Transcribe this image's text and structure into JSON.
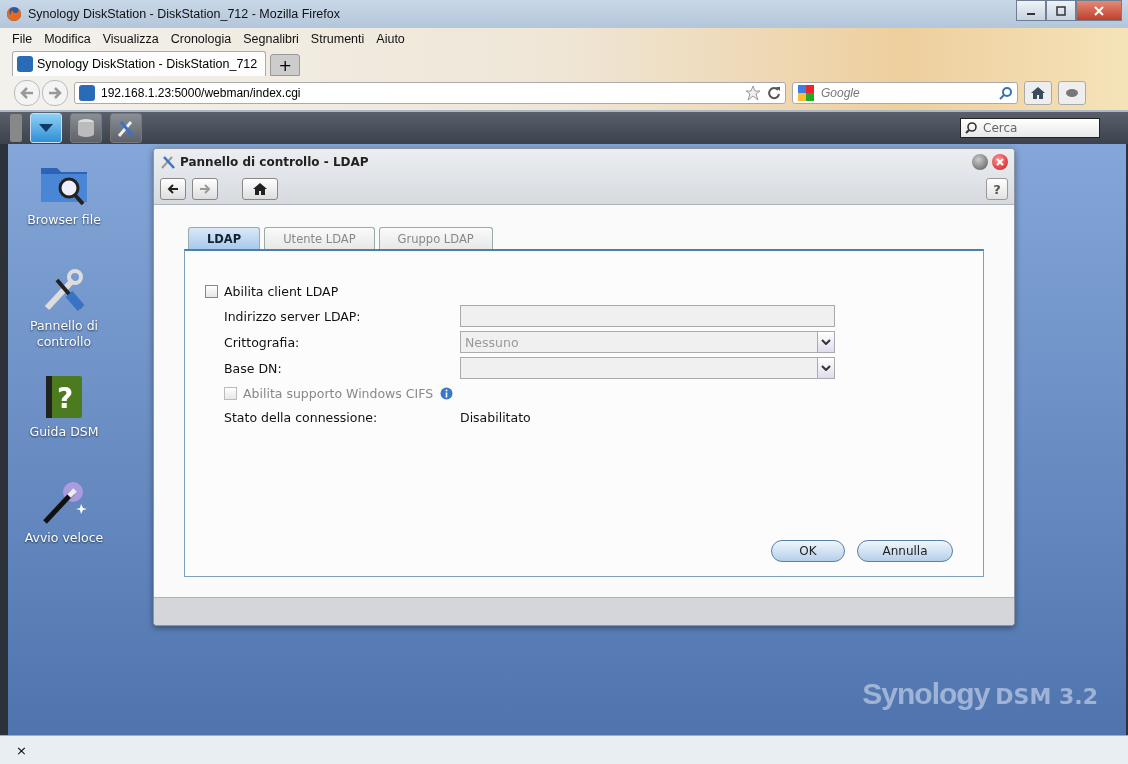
{
  "window": {
    "title": "Synology DiskStation - DiskStation_712 - Mozilla Firefox"
  },
  "menu": [
    "File",
    "Modifica",
    "Visualizza",
    "Cronologia",
    "Segnalibri",
    "Strumenti",
    "Aiuto"
  ],
  "browser_tabs": [
    {
      "label": "Synology DiskStation - DiskStation_712",
      "selected": true
    }
  ],
  "new_tab": "+",
  "address_bar": {
    "value": "192.168.1.23:5000/webman/index.cgi"
  },
  "search_bar": {
    "placeholder": "Google"
  },
  "dsm_taskbar": {
    "search": {
      "placeholder": "Cerca"
    }
  },
  "desktop": {
    "icons": [
      {
        "kind": "folder",
        "label": "Browser file"
      },
      {
        "kind": "tools",
        "label": "Pannello di controllo"
      },
      {
        "kind": "help",
        "label": "Guida DSM",
        "glyph": "?"
      },
      {
        "kind": "wand",
        "label": "Avvio veloce"
      }
    ],
    "logo": {
      "brand": "Synology",
      "product": "DSM 3.2"
    }
  },
  "dialog": {
    "title": "Pannello di controllo - LDAP",
    "help": "?",
    "tabs": [
      {
        "label": "LDAP",
        "selected": true
      },
      {
        "label": "Utente LDAP",
        "selected": false
      },
      {
        "label": "Gruppo LDAP",
        "selected": false
      }
    ],
    "enable_client": {
      "label": "Abilita client LDAP",
      "checked": false
    },
    "fields": [
      {
        "kind": "text",
        "label": "Indirizzo server LDAP:",
        "disabled": true
      },
      {
        "kind": "select",
        "label": "Crittografia:",
        "value": "Nessuno",
        "disabled": true
      },
      {
        "kind": "select",
        "label": "Base DN:",
        "disabled": true
      }
    ],
    "cifs": {
      "label": "Abilita supporto Windows CIFS",
      "checked": false,
      "disabled": true
    },
    "status": {
      "label": "Stato della connessione:",
      "value": "Disabilitato"
    },
    "buttons": [
      "OK",
      "Annulla"
    ]
  },
  "status_bar": {
    "close": "×"
  }
}
